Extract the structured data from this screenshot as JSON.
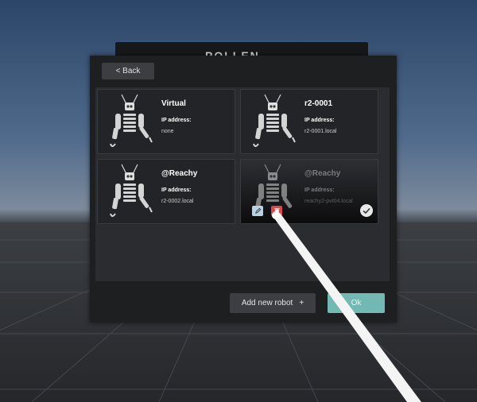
{
  "header": {
    "brand_text": "POLLEN"
  },
  "toolbar": {
    "back_label": "< Back"
  },
  "robots": [
    {
      "name": "Virtual",
      "ip_label": "IP address:",
      "ip": "none"
    },
    {
      "name": "r2-0001",
      "ip_label": "IP address:",
      "ip": "r2-0001.local"
    },
    {
      "name": "@Reachy",
      "ip_label": "IP address:",
      "ip": "r2-0002.local"
    },
    {
      "name": "@Reachy",
      "ip_label": "IP address:",
      "ip": "reachy2-pvt04.local",
      "selected": true
    }
  ],
  "footer": {
    "add_label": "Add new robot",
    "add_icon": "+",
    "ok_label": "Ok"
  },
  "colors": {
    "accent": "#72b9b3",
    "delete": "#d9484c",
    "edit": "#b9d3e0",
    "panel": "#1e1f21"
  }
}
